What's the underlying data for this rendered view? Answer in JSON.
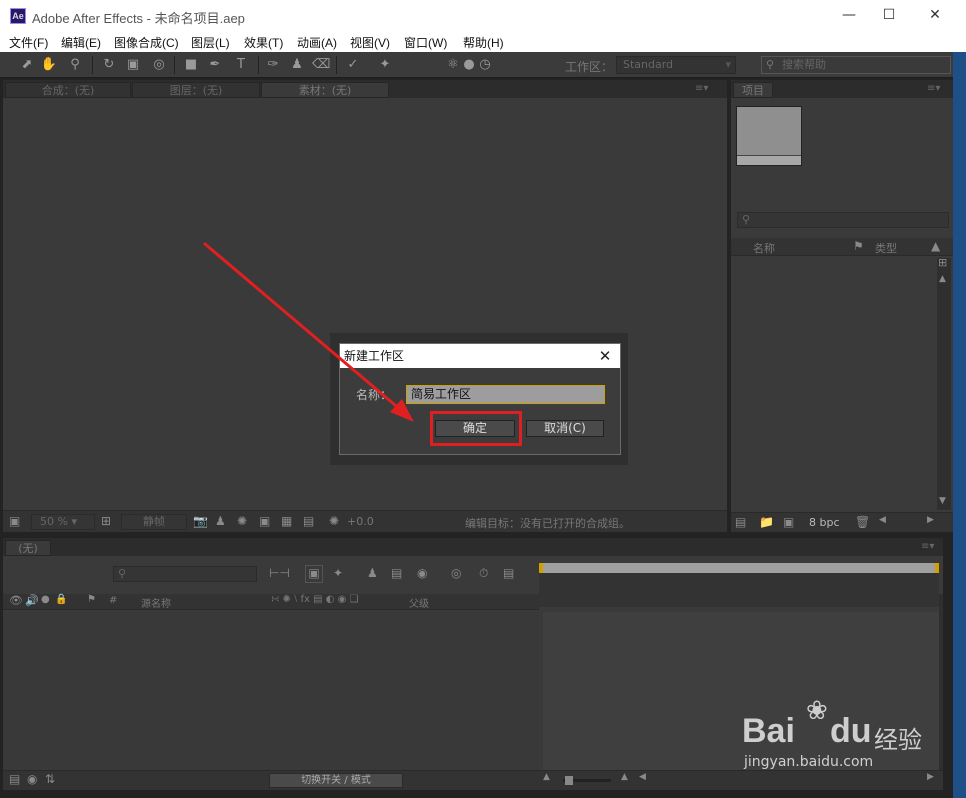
{
  "titlebar": {
    "logo": "Ae",
    "title": "Adobe After Effects - 未命名项目.aep",
    "minimize_icon": "minimize-icon",
    "maximize_icon": "maximize-icon",
    "close_icon": "close-icon"
  },
  "menu": [
    "文件(F)",
    "编辑(E)",
    "图像合成(C)",
    "图层(L)",
    "效果(T)",
    "动画(A)",
    "视图(V)",
    "窗口(W)",
    "帮助(H)"
  ],
  "toolbar": {
    "workspace_label": "工作区：",
    "workspace_value": "Standard",
    "help_placeholder": "搜索帮助"
  },
  "viewer_tabs": {
    "comp": "合成：(无)",
    "layer": "图层：(无)",
    "footage": "素材：(无)"
  },
  "viewer_footer": {
    "zoom": "50 %",
    "frame": "静帧",
    "exposure": "+0.0",
    "edit_target": "编辑目标：没有已打开的合成组。"
  },
  "project": {
    "tab": "项目",
    "col_name": "名称",
    "col_type": "类型",
    "bpc": "8 bpc"
  },
  "timeline": {
    "tab": "(无)",
    "col_source": "源名称",
    "col_parent": "父级",
    "toggle_label": "切换开关 / 模式"
  },
  "dialog": {
    "title": "新建工作区",
    "name_label": "名称：",
    "name_value": "简易工作区",
    "ok": "确定",
    "cancel": "取消(C)"
  },
  "watermark": {
    "brand": "Bai",
    "brand2": "du",
    "suffix": "经验",
    "url": "jingyan.baidu.com"
  },
  "colors": {
    "annotation": "#e02020",
    "panel_bg": "#3a3a3a",
    "dialog_border_focus": "#d0a000"
  }
}
